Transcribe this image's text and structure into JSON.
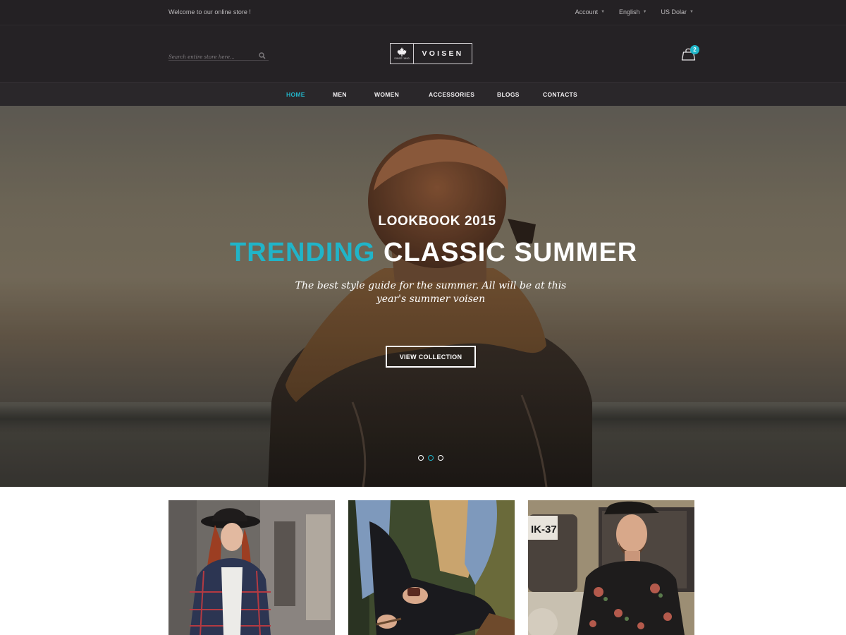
{
  "topbar": {
    "welcome": "Welcome to our online store !",
    "links": [
      {
        "label": "Account"
      },
      {
        "label": "English"
      },
      {
        "label": "US Dolar"
      }
    ]
  },
  "header": {
    "search": {
      "placeholder": "Search entire store here..."
    },
    "logo": {
      "word": "VOISEN",
      "since": "SINCE 1990"
    },
    "cart": {
      "count": "2"
    }
  },
  "nav": {
    "items": [
      {
        "label": "HOME",
        "active": true
      },
      {
        "label": "MEN"
      },
      {
        "label": "WOMEN"
      },
      {
        "label": "ACCESSORIES"
      },
      {
        "label": "BLOGS"
      },
      {
        "label": "CONTACTS"
      }
    ]
  },
  "hero": {
    "eyebrow": "LOOKBOOK 2015",
    "title_accent": "TRENDING",
    "title_main": " CLASSIC SUMMER",
    "description": "The best style guide for the summer. All will be at this year's summer voisen",
    "cta_label": "VIEW COLLECTION",
    "slides_count": 3,
    "active_slide": 2
  },
  "thumbnails": [
    {
      "subject": "woman-plaid-shirt-hat"
    },
    {
      "subject": "woman-sitting-watch"
    },
    {
      "subject": "man-floral-shirt-cap",
      "plate_text": "IK-37"
    }
  ],
  "colors": {
    "accent": "#21b4c8",
    "topbar_bg": "#242124",
    "header_bg": "#252225",
    "nav_bg": "#2a272a"
  }
}
